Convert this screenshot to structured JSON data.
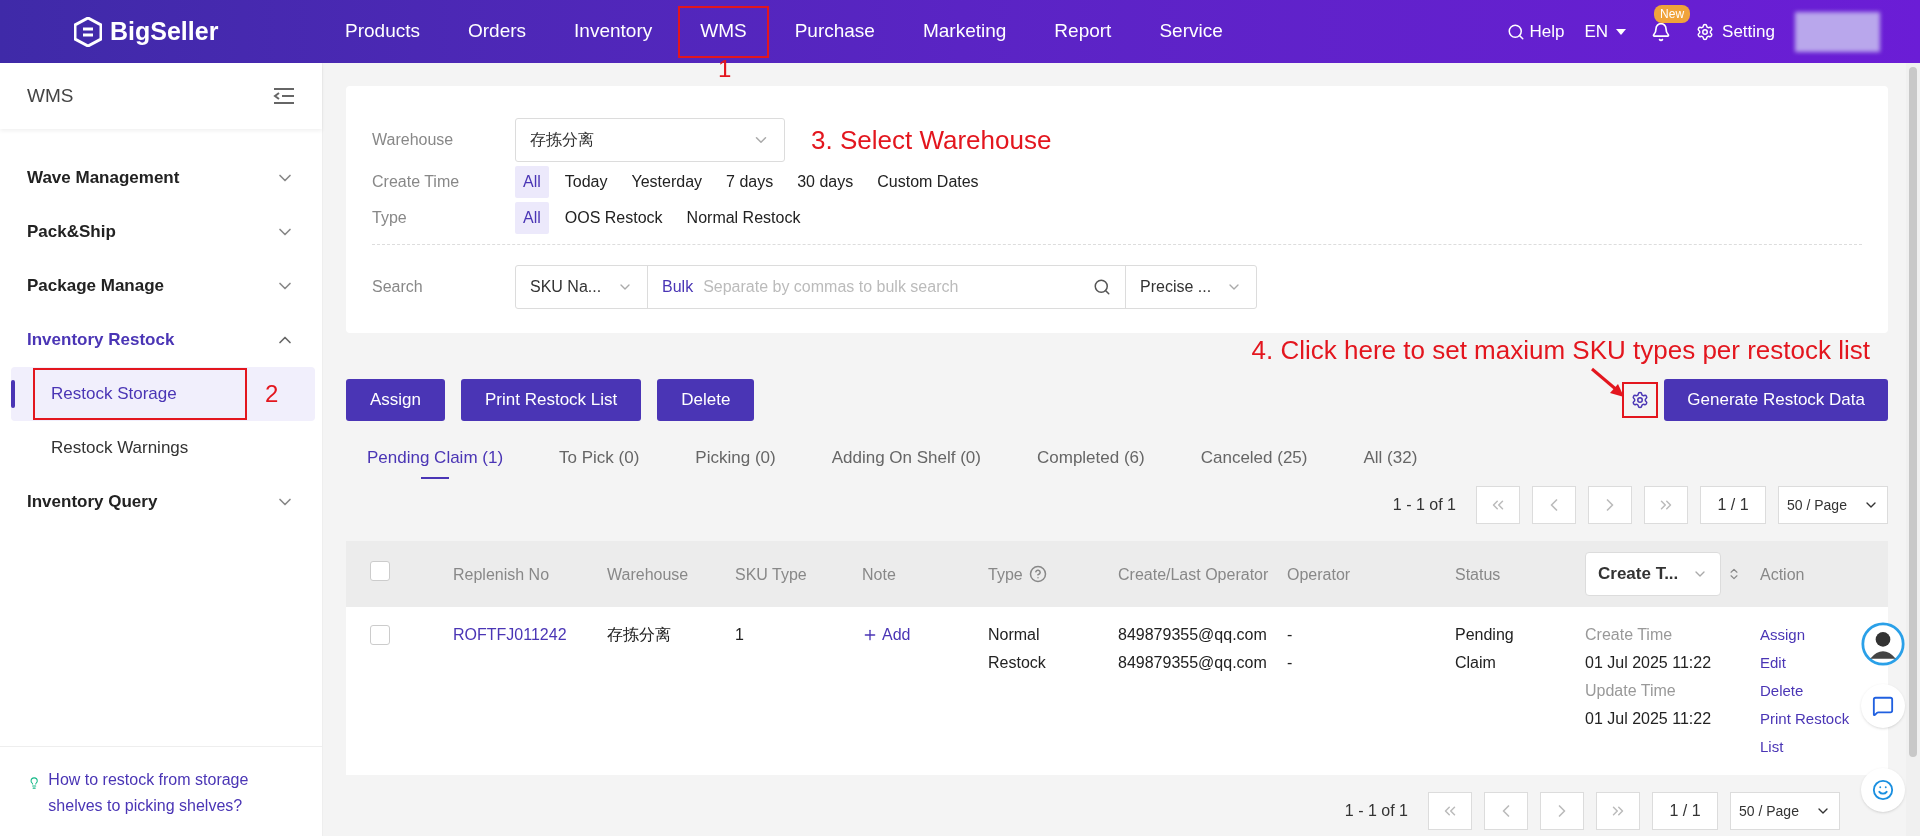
{
  "top_nav": {
    "logo": "BigSeller",
    "items": [
      {
        "label": "Products",
        "highlighted": false
      },
      {
        "label": "Orders",
        "highlighted": false
      },
      {
        "label": "Inventory",
        "highlighted": false
      },
      {
        "label": "WMS",
        "highlighted": true
      },
      {
        "label": "Purchase",
        "highlighted": false
      },
      {
        "label": "Marketing",
        "highlighted": false
      },
      {
        "label": "Report",
        "highlighted": false
      },
      {
        "label": "Service",
        "highlighted": false
      }
    ],
    "help": "Help",
    "language": "EN",
    "notification_badge": "New",
    "settings": "Setting"
  },
  "sidebar": {
    "title": "WMS",
    "groups": [
      {
        "label": "Wave Management",
        "expanded": false
      },
      {
        "label": "Pack&Ship",
        "expanded": false
      },
      {
        "label": "Package Manage",
        "expanded": false
      },
      {
        "label": "Inventory Restock",
        "expanded": true,
        "children": [
          {
            "label": "Restock Storage",
            "selected": true,
            "highlighted": true
          },
          {
            "label": "Restock Warnings",
            "selected": false,
            "highlighted": false
          }
        ]
      },
      {
        "label": "Inventory Query",
        "expanded": false
      }
    ],
    "help_link": "How to restock from storage shelves to picking shelves?"
  },
  "filters": {
    "warehouse": {
      "label": "Warehouse",
      "value": "存拣分离"
    },
    "create_time": {
      "label": "Create Time",
      "options": [
        {
          "label": "All",
          "selected": true
        },
        {
          "label": "Today",
          "selected": false
        },
        {
          "label": "Yesterday",
          "selected": false
        },
        {
          "label": "7 days",
          "selected": false
        },
        {
          "label": "30 days",
          "selected": false
        },
        {
          "label": "Custom Dates",
          "selected": false
        }
      ]
    },
    "type": {
      "label": "Type",
      "options": [
        {
          "label": "All",
          "selected": true
        },
        {
          "label": "OOS Restock",
          "selected": false
        },
        {
          "label": "Normal Restock",
          "selected": false
        }
      ]
    },
    "search": {
      "label": "Search",
      "field_select": "SKU Na...",
      "bulk": "Bulk",
      "placeholder": "Separate by commas to bulk search",
      "match_select": "Precise ..."
    }
  },
  "actions": [
    "Assign",
    "Print Restock List",
    "Delete"
  ],
  "settings_highlighted": true,
  "generate_button": "Generate Restock Data",
  "tabs": [
    {
      "label": "Pending Claim (1)",
      "selected": true
    },
    {
      "label": "To Pick (0)",
      "selected": false
    },
    {
      "label": "Picking (0)",
      "selected": false
    },
    {
      "label": "Adding On Shelf (0)",
      "selected": false
    },
    {
      "label": "Completed (6)",
      "selected": false
    },
    {
      "label": "Canceled (25)",
      "selected": false
    },
    {
      "label": "All (32)",
      "selected": false
    }
  ],
  "pagination_top": {
    "range": "1 - 1 of 1",
    "page": "1 / 1",
    "page_size": "50 / Page"
  },
  "table": {
    "select_all": {
      "checked": false
    },
    "columns": [
      {
        "label": "Replenish No",
        "kind": "text"
      },
      {
        "label": "Warehouse",
        "kind": "text"
      },
      {
        "label": "SKU Type",
        "kind": "text"
      },
      {
        "label": "Note",
        "kind": "text"
      },
      {
        "label": "Type",
        "kind": "help"
      },
      {
        "label": "Create/Last Operator",
        "kind": "text"
      },
      {
        "label": "Operator",
        "kind": "text"
      },
      {
        "label": "Status",
        "kind": "text"
      },
      {
        "label": "Create T...",
        "kind": "select"
      },
      {
        "label": "Action",
        "kind": "text"
      }
    ],
    "rows": [
      {
        "checked": false,
        "replenish_no": "ROFTFJ011242",
        "warehouse": "存拣分离",
        "sku_type": "1",
        "note": "Add",
        "type": "Normal Restock",
        "operator_emails": [
          "849879355@qq.com",
          "849879355@qq.com"
        ],
        "operator": [
          "-",
          "-"
        ],
        "status": "Pending Claim",
        "times": [
          {
            "label": "Create Time",
            "value": "01 Jul 2025 11:22"
          },
          {
            "label": "Update Time",
            "value": "01 Jul 2025 11:22"
          }
        ],
        "actions": [
          "Assign",
          "Edit",
          "Delete",
          "Print Restock List"
        ]
      }
    ]
  },
  "pagination_bottom": {
    "range": "1 - 1 of 1",
    "page": "1 / 1",
    "page_size": "50 / Page"
  },
  "annotations": {
    "nav_marker": "1",
    "sidebar_marker": "2",
    "warehouse_hint": "3. Select Warehouse",
    "settings_hint": "4. Click here to set maxium SKU types per restock list"
  }
}
